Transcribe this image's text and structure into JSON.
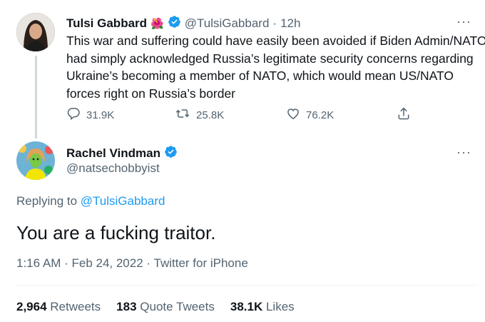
{
  "tweet1": {
    "author_name": "Tulsi Gabbard",
    "author_emoji": "🌺",
    "handle": "@TulsiGabbard",
    "separator": "·",
    "time": "12h",
    "more": "···",
    "text_lines": [
      "This war and suffering could have easily been avoided if Biden Admin/NATO",
      "had simply acknowledged Russia’s legitimate security concerns regarding",
      "Ukraine’s becoming a member of NATO, which would mean US/NATO",
      "forces right on Russia’s border"
    ],
    "replies": "31.9K",
    "retweets": "25.8K",
    "likes": "76.2K"
  },
  "tweet2": {
    "author_name": "Rachel Vindman",
    "handle": "@natsechobbyist",
    "more": "···",
    "replying_prefix": "Replying to ",
    "replying_handle": "@TulsiGabbard",
    "text": "You are a fucking traitor.",
    "time": "1:16 AM",
    "date": "Feb 24, 2022",
    "source": "Twitter for iPhone",
    "meta_sep": " · ",
    "retweets_count": "2,964",
    "retweets_label": "Retweets",
    "quote_count": "183",
    "quote_label": "Quote Tweets",
    "likes_count": "38.1K",
    "likes_label": "Likes"
  },
  "colors": {
    "verified": "#1d9bf0",
    "link": "#1d9bf0",
    "secondary": "#536471"
  },
  "icons": [
    "reply-icon",
    "retweet-icon",
    "like-icon",
    "share-icon",
    "verified-badge-icon",
    "more-icon"
  ]
}
